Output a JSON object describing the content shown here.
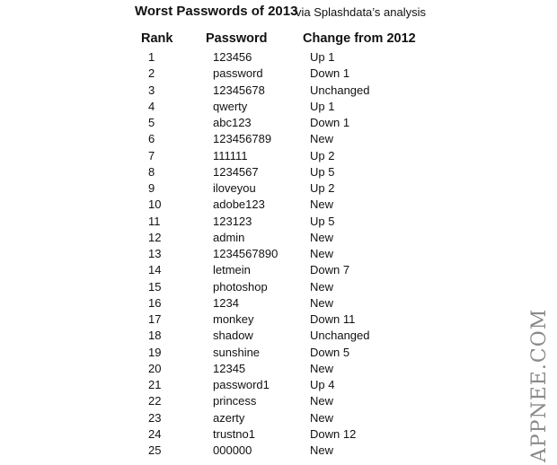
{
  "title": "Worst Passwords of 2013",
  "subtitle": "via Splashdata’s analysis",
  "columns": {
    "rank": "Rank",
    "password": "Password",
    "change": "Change from 2012"
  },
  "rows": [
    {
      "rank": "1",
      "password": "123456",
      "change": "Up 1"
    },
    {
      "rank": "2",
      "password": "password",
      "change": "Down 1"
    },
    {
      "rank": "3",
      "password": "12345678",
      "change": "Unchanged"
    },
    {
      "rank": "4",
      "password": "qwerty",
      "change": "Up 1"
    },
    {
      "rank": "5",
      "password": "abc123",
      "change": "Down 1"
    },
    {
      "rank": "6",
      "password": "123456789",
      "change": "New"
    },
    {
      "rank": "7",
      "password": "111111",
      "change": "Up 2"
    },
    {
      "rank": "8",
      "password": "1234567",
      "change": "Up 5"
    },
    {
      "rank": "9",
      "password": "iloveyou",
      "change": "Up 2"
    },
    {
      "rank": "10",
      "password": "adobe123",
      "change": "New"
    },
    {
      "rank": "11",
      "password": "123123",
      "change": "Up 5"
    },
    {
      "rank": "12",
      "password": "admin",
      "change": "New"
    },
    {
      "rank": "13",
      "password": "1234567890",
      "change": "New"
    },
    {
      "rank": "14",
      "password": "letmein",
      "change": "Down 7"
    },
    {
      "rank": "15",
      "password": "photoshop",
      "change": "New"
    },
    {
      "rank": "16",
      "password": "1234",
      "change": "New"
    },
    {
      "rank": "17",
      "password": "monkey",
      "change": "Down 11"
    },
    {
      "rank": "18",
      "password": "shadow",
      "change": "Unchanged"
    },
    {
      "rank": "19",
      "password": "sunshine",
      "change": "Down 5"
    },
    {
      "rank": "20",
      "password": "12345",
      "change": "New"
    },
    {
      "rank": "21",
      "password": "password1",
      "change": "Up 4"
    },
    {
      "rank": "22",
      "password": "princess",
      "change": "New"
    },
    {
      "rank": "23",
      "password": "azerty",
      "change": "New"
    },
    {
      "rank": "24",
      "password": "trustno1",
      "change": "Down 12"
    },
    {
      "rank": "25",
      "password": "000000",
      "change": "New"
    }
  ],
  "watermark": "APPNEE.COM"
}
